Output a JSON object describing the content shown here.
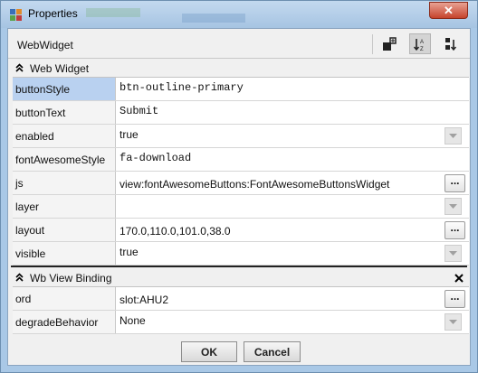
{
  "window": {
    "title": "Properties",
    "close_glyph": "✕"
  },
  "header": {
    "title": "WebWidget"
  },
  "toolbar": [
    {
      "icon": "add-slot-icon"
    },
    {
      "icon": "sort-alpha-icon",
      "active": true
    },
    {
      "icon": "sort-order-icon"
    }
  ],
  "sections": [
    {
      "label": "Web Widget",
      "rows": [
        {
          "name": "buttonStyle",
          "value": "btn-outline-primary",
          "control": "none",
          "selected": true
        },
        {
          "name": "buttonText",
          "value": "Submit",
          "control": "none"
        },
        {
          "name": "enabled",
          "value": "true",
          "control": "dropdown"
        },
        {
          "name": "fontAwesomeStyle",
          "value": "fa-download",
          "control": "none"
        },
        {
          "name": "js",
          "value": "view:fontAwesomeButtons:FontAwesomeButtonsWidget",
          "control": "dots"
        },
        {
          "name": "layer",
          "value": "",
          "control": "dropdown"
        },
        {
          "name": "layout",
          "value": "170.0,110.0,101.0,38.0",
          "control": "dots"
        },
        {
          "name": "visible",
          "value": "true",
          "control": "dropdown"
        }
      ]
    },
    {
      "label": "Wb View Binding",
      "rows": [
        {
          "name": "ord",
          "value": "slot:AHU2",
          "control": "dots"
        },
        {
          "name": "degradeBehavior",
          "value": "None",
          "control": "dropdown"
        }
      ]
    }
  ],
  "buttons": {
    "ok": "OK",
    "cancel": "Cancel",
    "dots": "..."
  }
}
